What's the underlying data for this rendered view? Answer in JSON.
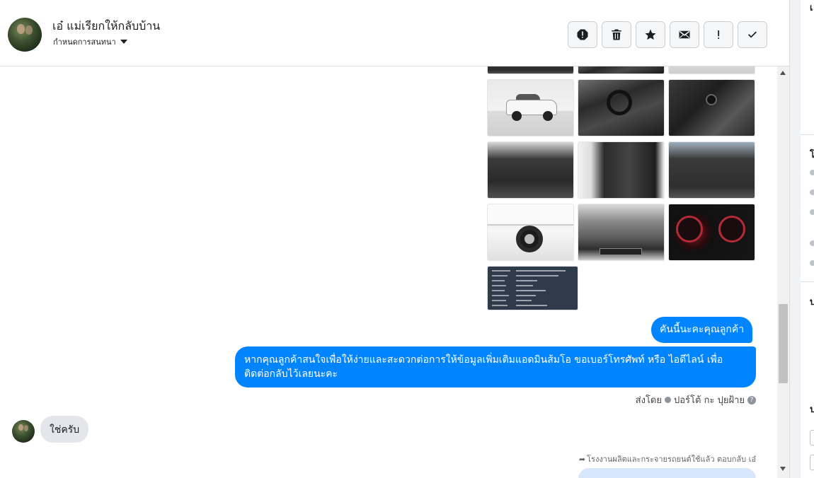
{
  "header": {
    "name": "เอ๋ แม่เรียกให้กลับบ้าน",
    "subtitle": "กำหนดการสนทนา",
    "toolbar": [
      "spam-icon",
      "trash-icon",
      "star-icon",
      "envelope-icon",
      "exclamation-icon",
      "check-icon"
    ]
  },
  "messages": {
    "outgoing_1": "คันนี้นะคะคุณลูกค้า",
    "outgoing_2": "หากคุณลูกค้าสนใจเพื่อให้ง่ายและสะดวกต่อการให้ข้อมูลเพิ่มเติมแอดมินส้มโอ ขอเบอร์โทรศัพท์ หรือ ไอดีไลน์ เพื่อติดต่อกลับไว้เลยนะคะ",
    "sent_by_label": "ส่งโดย",
    "sent_by_name": "ปอร์โต้ กะ ปุยฝ้าย",
    "incoming_1": "ใช่ครับ",
    "reply_note": "โรงงานผลิตและกระจายรถยนต์ใช้แล้ว ตอบกลับ เอ๋"
  },
  "photos": {
    "row1": [
      "truck-exterior",
      "dashboard",
      "gear-shift"
    ],
    "row2": [
      "front-interior",
      "door-panel",
      "rear-seats"
    ],
    "row3": [
      "wheel",
      "engine",
      "gauges"
    ],
    "row4": [
      "spec-sheet"
    ]
  },
  "right_panel": {
    "chars": [
      "เ",
      "โ",
      "บ",
      "ป"
    ]
  },
  "colors": {
    "accent": "#0084ff",
    "incoming_bubble": "#e4e6eb"
  }
}
